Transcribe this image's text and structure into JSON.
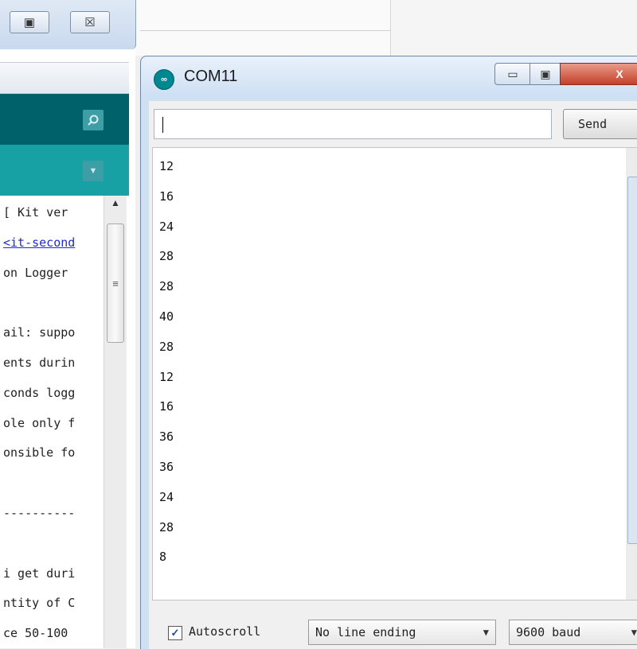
{
  "ide": {
    "restore_glyph": "▣",
    "close_glyph": "☒",
    "code_lines": [
      {
        "text": "[ Kit ver",
        "link": false
      },
      {
        "text": "<it-second",
        "link": true
      },
      {
        "text": "on Logger",
        "link": false
      },
      {
        "text": "",
        "link": false
      },
      {
        "text": "ail: suppo",
        "link": false
      },
      {
        "text": "ents durin",
        "link": false
      },
      {
        "text": "conds logg",
        "link": false
      },
      {
        "text": "ole only f",
        "link": false
      },
      {
        "text": "onsible fo",
        "link": false
      },
      {
        "text": "",
        "link": false
      },
      {
        "text": "----------",
        "link": false
      },
      {
        "text": "",
        "link": false
      },
      {
        "text": "i get duri",
        "link": false
      },
      {
        "text": "ntity of C",
        "link": false
      },
      {
        "text": "ce 50-100",
        "link": false
      }
    ]
  },
  "serial": {
    "title": "COM11",
    "send_label": "Send",
    "input_value": "",
    "output_lines": [
      "12",
      "16",
      "24",
      "28",
      "28",
      "40",
      "28",
      "12",
      "16",
      "36",
      "36",
      "24",
      "28",
      "8"
    ],
    "autoscroll_label": "Autoscroll",
    "autoscroll_checked": "✓",
    "line_ending": "No line ending",
    "baud": "9600 baud"
  },
  "colors": {
    "arduino_teal": "#00616a",
    "arduino_tab_teal": "#17a1a5",
    "link_blue": "#1c2ec9"
  }
}
